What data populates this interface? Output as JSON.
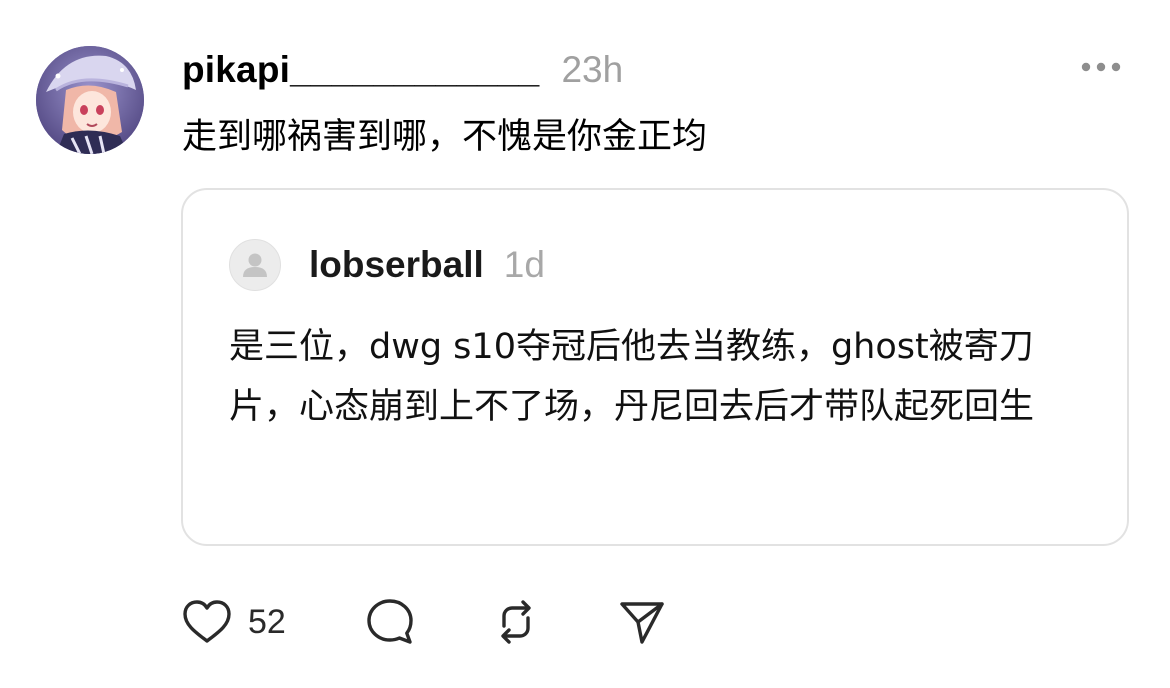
{
  "post": {
    "username": "pikapi____________",
    "timestamp": "23h",
    "text": "走到哪祸害到哪，不愧是你金正均",
    "avatar_icon": "anime-character-avatar",
    "more_icon": "ellipsis-icon"
  },
  "quoted_post": {
    "username": "lobserball",
    "timestamp": "1d",
    "avatar_icon": "default-user-icon",
    "text": "是三位，dwg s10夺冠后他去当教练，ghost被寄刀片，心态崩到上不了场，丹尼回去后才带队起死回生"
  },
  "actions": {
    "like_icon": "heart-icon",
    "like_count": "52",
    "reply_icon": "comment-bubble-icon",
    "repost_icon": "repost-icon",
    "share_icon": "send-icon"
  },
  "colors": {
    "text": "#000000",
    "muted": "#a0a0a0",
    "card_border": "#e2e2e2",
    "icon": "#2a2a2a"
  }
}
